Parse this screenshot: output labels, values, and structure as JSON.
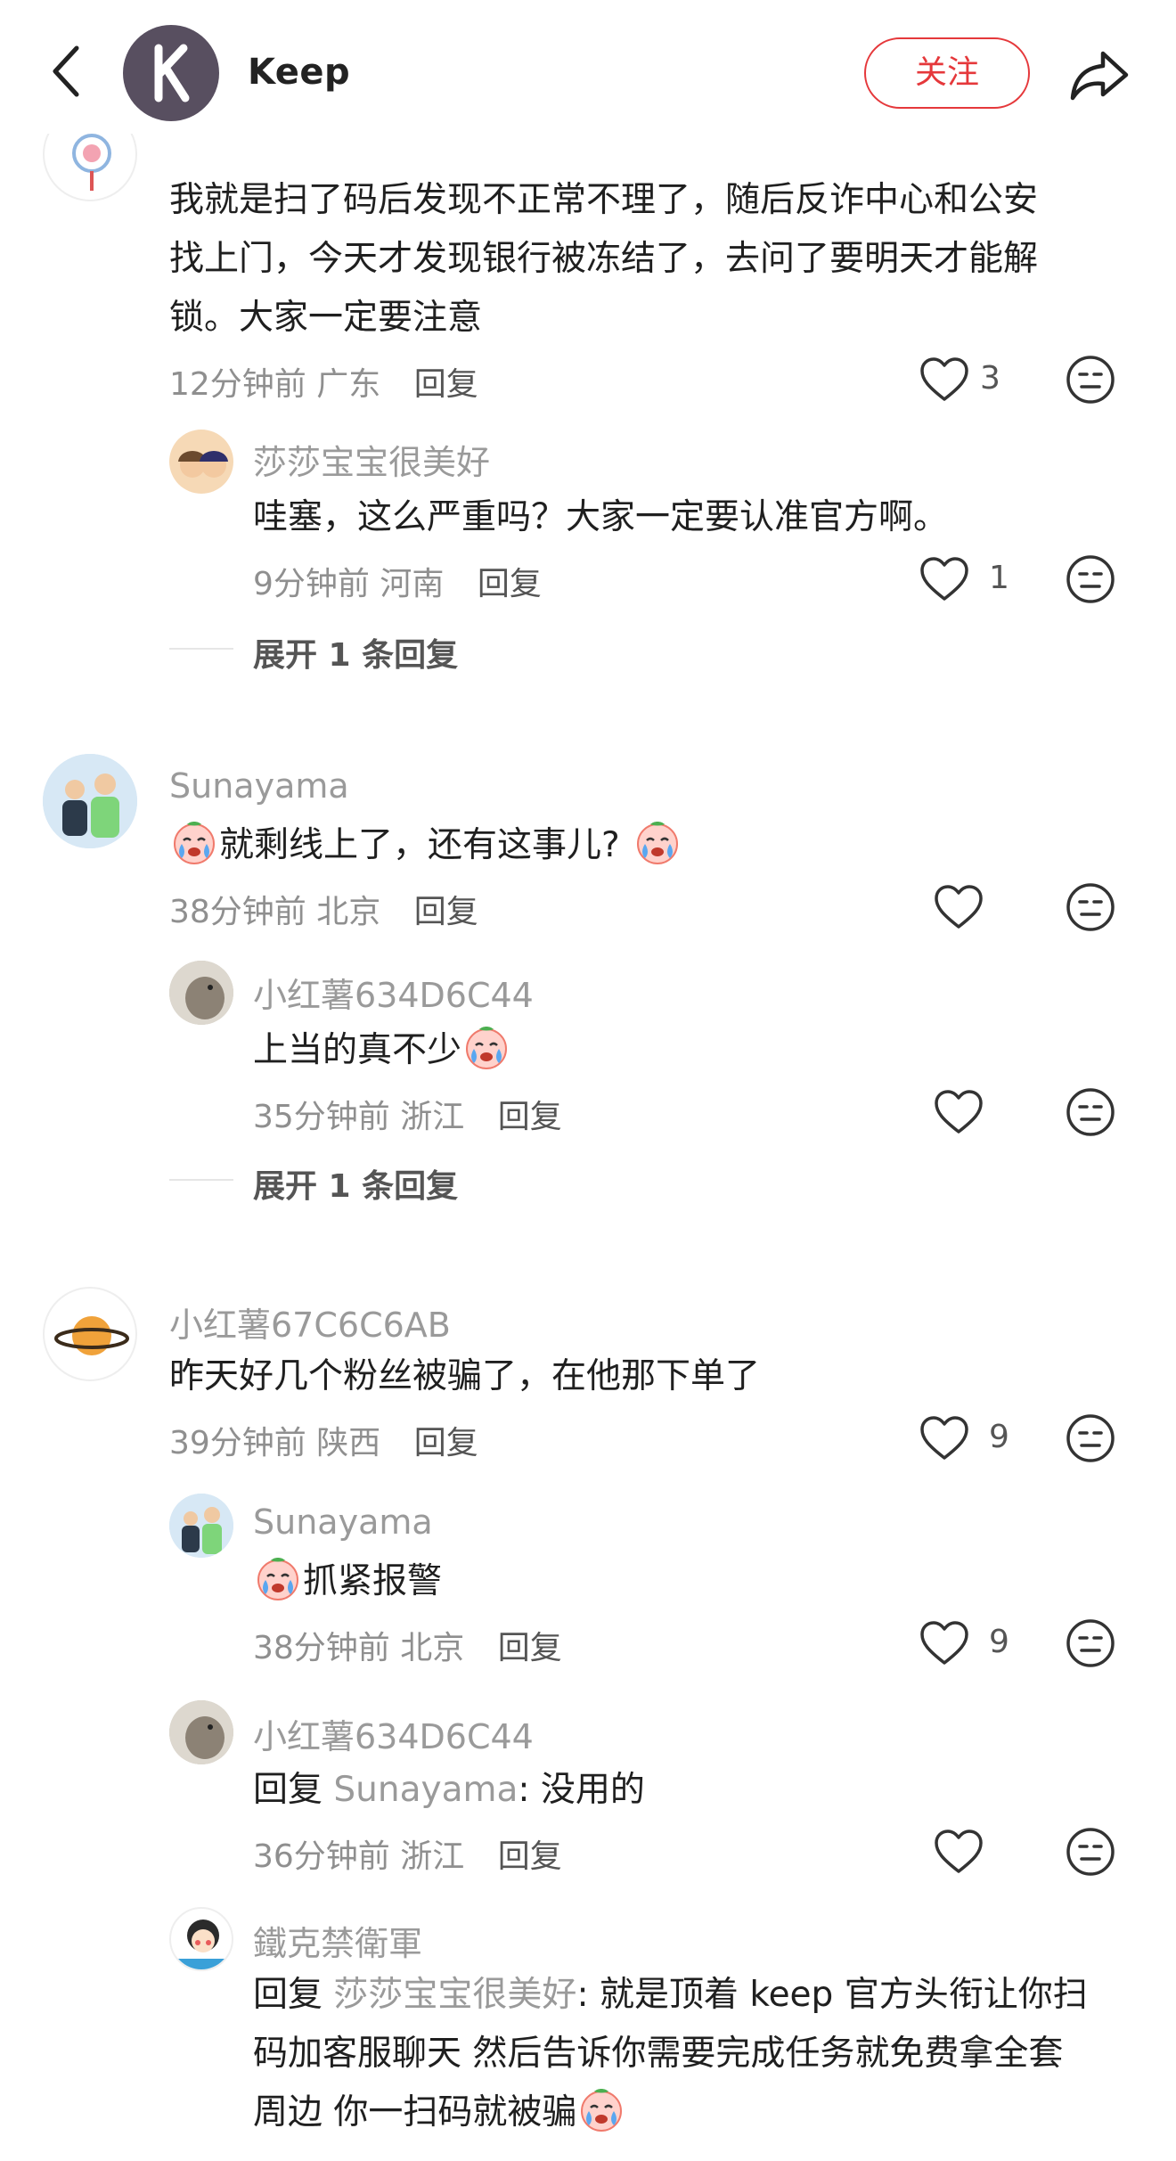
{
  "header": {
    "brand_name": "Keep",
    "follow_label": "关注"
  },
  "comments": [
    {
      "name": "",
      "lines": [
        "我就是扫了码后发现不正常不理了，随后反诈中心和公安",
        "找上门，今天才发现银行被冻结了，去问了要明天才能解",
        "锁。大家一定要注意"
      ],
      "time": "12分钟前",
      "location": "广东",
      "reply_label": "回复",
      "likes": "3",
      "replies": [
        {
          "name": "莎莎宝宝很美好",
          "text": "哇塞，这么严重吗？大家一定要认准官方啊。",
          "time": "9分钟前",
          "location": "河南",
          "reply_label": "回复",
          "likes": "1"
        }
      ],
      "expand_label": "展开 1 条回复"
    },
    {
      "name": "Sunayama",
      "text": "就剩线上了，还有这事儿?",
      "time": "38分钟前",
      "location": "北京",
      "reply_label": "回复",
      "likes": "",
      "replies": [
        {
          "name": "小红薯634D6C44",
          "text": "上当的真不少",
          "time": "35分钟前",
          "location": "浙江",
          "reply_label": "回复",
          "likes": ""
        }
      ],
      "expand_label": "展开 1 条回复"
    },
    {
      "name": "小红薯67C6C6AB",
      "text": "昨天好几个粉丝被骗了，在他那下单了",
      "time": "39分钟前",
      "location": "陕西",
      "reply_label": "回复",
      "likes": "9",
      "replies": [
        {
          "name": "Sunayama",
          "text": "抓紧报警",
          "time": "38分钟前",
          "location": "北京",
          "reply_label": "回复",
          "likes": "9"
        },
        {
          "name": "小红薯634D6C44",
          "prefix": "回复",
          "mention": "Sunayama",
          "text": ": 没用的",
          "time": "36分钟前",
          "location": "浙江",
          "reply_label": "回复",
          "likes": ""
        },
        {
          "name": "鐵克禁衛軍",
          "prefix": "回复",
          "mention": "莎莎宝宝很美好",
          "line1_rest": ": 就是顶着 keep 官方头衔让你扫",
          "line2": "码加客服聊天 然后告诉你需要完成任务就免费拿全套",
          "line3": "周边 你一扫码就被骗"
        }
      ]
    }
  ],
  "icons": {
    "back": "chevron-left-icon",
    "share": "share-arrow-icon",
    "like": "heart-outline-icon",
    "dislike": "neutral-face-icon",
    "emoji": "crying-emoji-icon"
  },
  "colors": {
    "accent": "#e5383b",
    "brand_avatar": "#584f60"
  }
}
